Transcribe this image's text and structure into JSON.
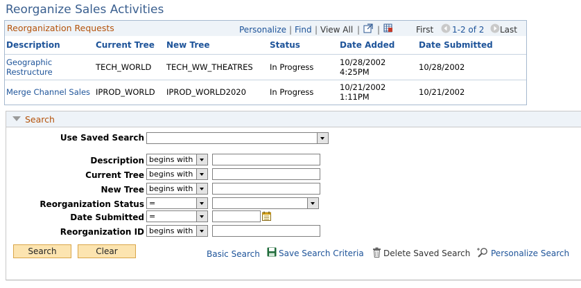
{
  "page": {
    "title": "Reorganize Sales Activities"
  },
  "grid": {
    "title": "Reorganization Requests",
    "nav": {
      "personalize": "Personalize",
      "find": "Find",
      "view_all": "View All",
      "first": "First",
      "range": "1-2 of 2",
      "last": "Last"
    },
    "columns": [
      "Description",
      "Current Tree",
      "New Tree",
      "Status",
      "Date Added",
      "Date Submitted"
    ],
    "rows": [
      {
        "description": [
          "Geographic",
          "Restructure"
        ],
        "current_tree": "TECH_WORLD",
        "new_tree": "TECH_WW_THEATRES",
        "status": "In Progress",
        "date_added": [
          "10/28/2002",
          "4:25PM"
        ],
        "date_submitted": "10/28/2002"
      },
      {
        "description": [
          "Merge Channel Sales"
        ],
        "current_tree": "IPROD_WORLD",
        "new_tree": "IPROD_WORLD2020",
        "status": "In Progress",
        "date_added": [
          "10/21/2002",
          "1:11PM"
        ],
        "date_submitted": "10/21/2002"
      }
    ]
  },
  "search": {
    "title": "Search",
    "use_saved_search": {
      "label": "Use Saved Search",
      "value": ""
    },
    "fields": {
      "description": {
        "label": "Description",
        "operator": "begins with",
        "value": ""
      },
      "current_tree": {
        "label": "Current Tree",
        "operator": "begins with",
        "value": ""
      },
      "new_tree": {
        "label": "New Tree",
        "operator": "begins with",
        "value": ""
      },
      "reorg_status": {
        "label": "Reorganization Status",
        "operator": "=",
        "value": ""
      },
      "date_submitted": {
        "label": "Date Submitted",
        "operator": "=",
        "value": ""
      },
      "reorg_id": {
        "label": "Reorganization ID",
        "operator": "begins with",
        "value": ""
      }
    },
    "buttons": {
      "search": "Search",
      "clear": "Clear"
    },
    "links": {
      "basic_search": "Basic Search",
      "save_criteria": "Save Search Criteria",
      "delete_saved": "Delete Saved Search",
      "personalize_search": "Personalize Search"
    }
  }
}
